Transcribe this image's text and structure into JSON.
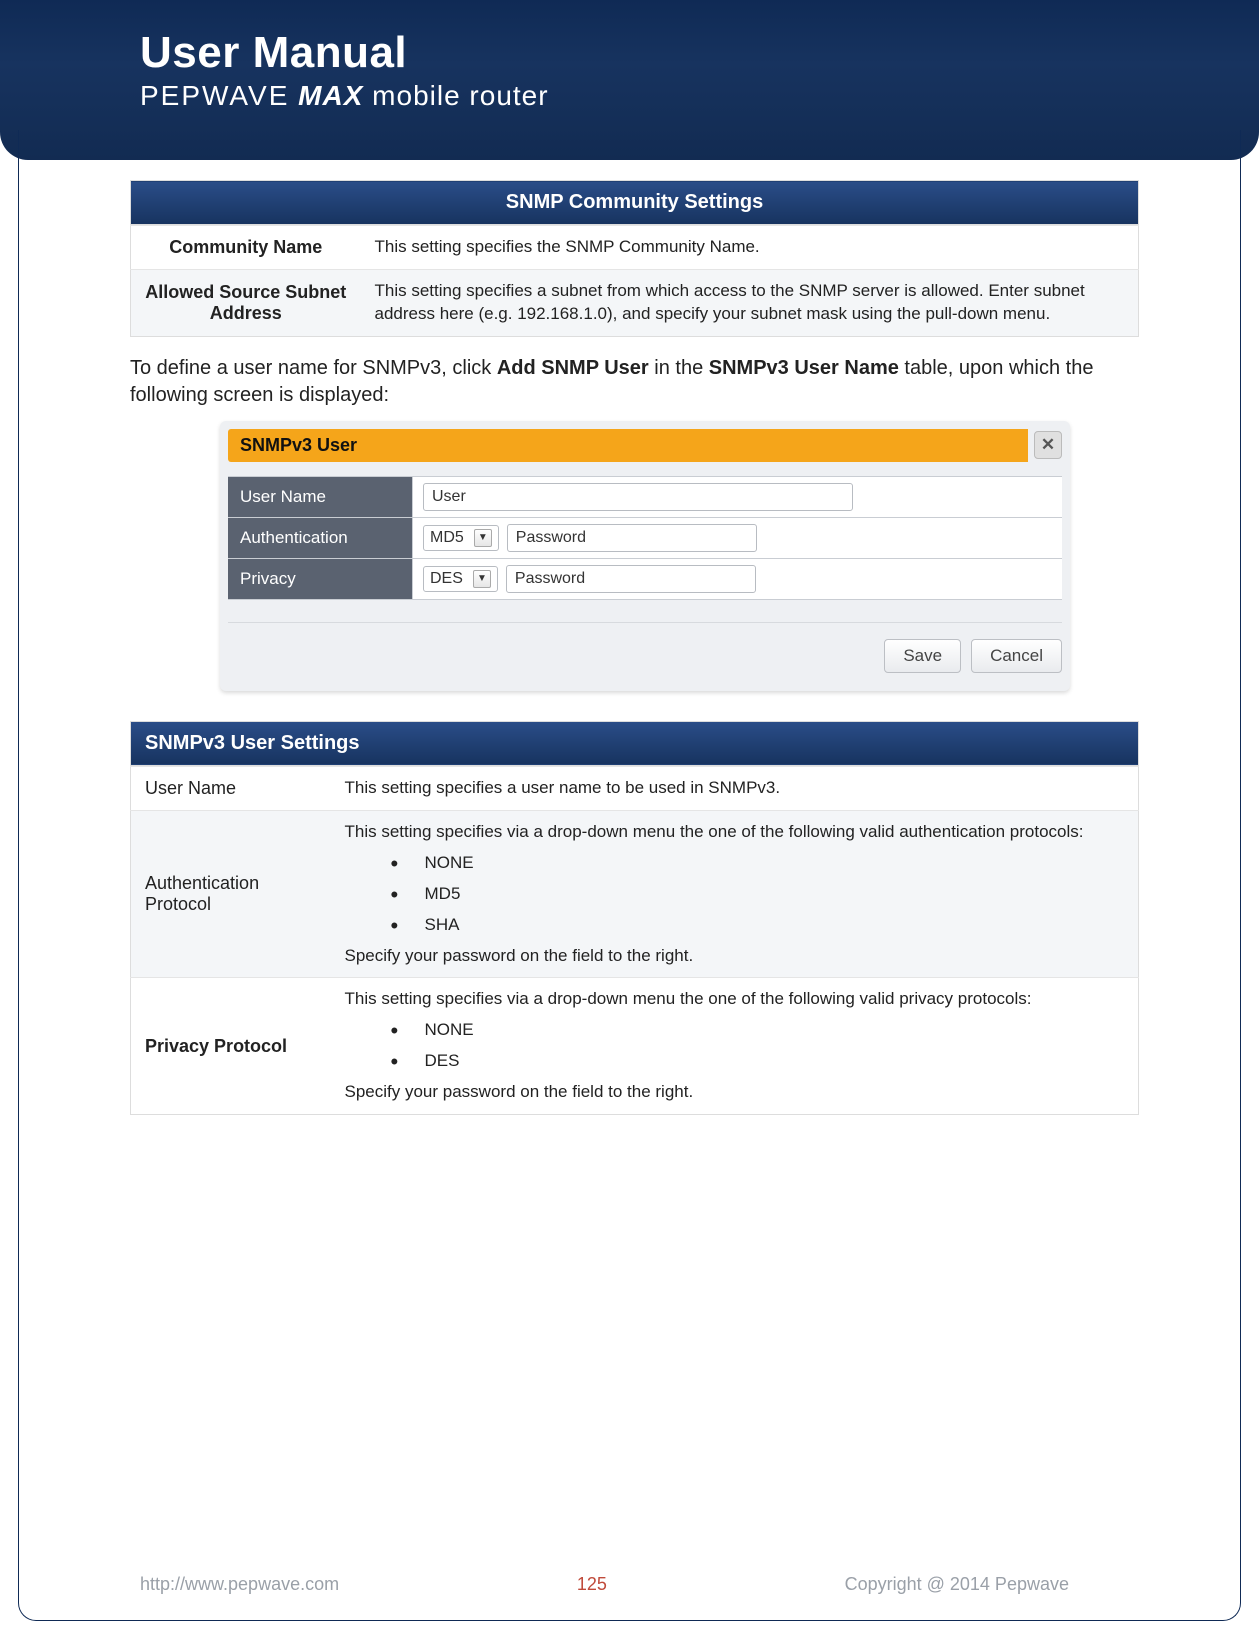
{
  "header": {
    "title": "User Manual",
    "brand": "PEPWAVE",
    "model": "MAX",
    "product": "mobile router"
  },
  "communityTable": {
    "title": "SNMP Community Settings",
    "rows": [
      {
        "label": "Community Name",
        "desc": "This setting specifies the SNMP Community Name."
      },
      {
        "label": "Allowed Source Subnet Address",
        "desc": "This setting specifies a subnet from which access to the SNMP server is allowed. Enter subnet address here (e.g. 192.168.1.0), and specify your subnet mask using the pull-down menu."
      }
    ]
  },
  "paragraph": {
    "pre": "To define a user name for SNMPv3, click ",
    "b1": "Add SNMP User",
    "mid": " in the ",
    "b2": "SNMPv3 User Name",
    "post": " table, upon which the following screen is displayed:"
  },
  "dialog": {
    "title": "SNMPv3 User",
    "rows": {
      "username_label": "User Name",
      "username_value": "User",
      "auth_label": "Authentication",
      "auth_select": "MD5",
      "auth_password": "Password",
      "priv_label": "Privacy",
      "priv_select": "DES",
      "priv_password": "Password"
    },
    "save": "Save",
    "cancel": "Cancel"
  },
  "userSettings": {
    "title": "SNMPv3 User Settings",
    "username": {
      "label": "User Name",
      "desc": "This setting specifies a user name to be used in SNMPv3."
    },
    "auth": {
      "label": "Authentication Protocol",
      "intro": "This setting specifies via a drop-down menu the one of the following valid authentication protocols:",
      "opts": [
        "NONE",
        "MD5",
        "SHA"
      ],
      "outro": "Specify your password on the field to the right."
    },
    "priv": {
      "label": "Privacy Protocol",
      "intro": "This setting specifies via a drop-down menu the one of the following valid privacy protocols:",
      "opts": [
        "NONE",
        "DES"
      ],
      "outro": "Specify your password on the field to the right."
    }
  },
  "footer": {
    "url": "http://www.pepwave.com",
    "page": "125",
    "copyright": "Copyright @ 2014 Pepwave"
  }
}
